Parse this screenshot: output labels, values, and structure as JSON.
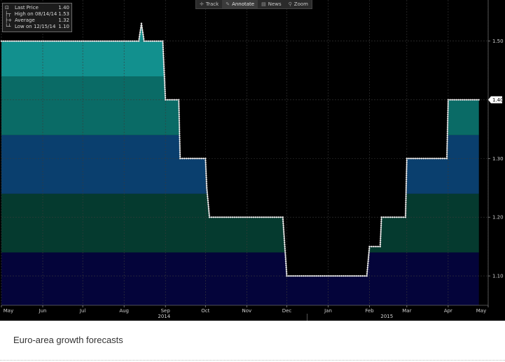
{
  "toolbar": {
    "items": [
      {
        "label": "Track",
        "icon": "crosshair-icon",
        "active": false
      },
      {
        "label": "Annotate",
        "icon": "pencil-icon",
        "active": true
      },
      {
        "label": "News",
        "icon": "news-icon",
        "active": false
      },
      {
        "label": "Zoom",
        "icon": "magnifier-icon",
        "active": false
      }
    ]
  },
  "legend": {
    "rows": [
      {
        "label": "Last Price",
        "value": "1.40"
      },
      {
        "label": "High on 08/14/14",
        "value": "1.53"
      },
      {
        "label": "Average",
        "value": "1.32"
      },
      {
        "label": "Low on 12/15/14",
        "value": "1.10"
      }
    ]
  },
  "caption": "Euro-area growth forecasts",
  "chart_data": {
    "type": "area",
    "title": "",
    "xlabel": "",
    "ylabel": "",
    "ylim": [
      1.05,
      1.57
    ],
    "x_range": [
      "2014-05-01",
      "2015-05-01"
    ],
    "x_ticks": [
      "May",
      "Jun",
      "Jul",
      "Aug",
      "Sep",
      "Oct",
      "Nov",
      "Dec",
      "Jan",
      "Feb",
      "Mar",
      "Apr",
      "May"
    ],
    "x_tick_dates": [
      "2014-05-01",
      "2014-06-01",
      "2014-07-01",
      "2014-08-01",
      "2014-09-01",
      "2014-10-01",
      "2014-11-01",
      "2014-12-01",
      "2015-01-01",
      "2015-02-01",
      "2015-03-01",
      "2015-04-01",
      "2015-05-01"
    ],
    "year_labels": [
      {
        "label": "2014",
        "date": "2014-08-31"
      },
      {
        "label": "2015",
        "date": "2015-02-14"
      }
    ],
    "y_ticks": [
      1.1,
      1.2,
      1.3,
      1.4,
      1.5
    ],
    "last_value_label": "1.40",
    "grid": true,
    "legend_position": "top-left",
    "series": [
      {
        "name": "Last Price",
        "points": [
          [
            "2014-05-01",
            1.5
          ],
          [
            "2014-08-12",
            1.5
          ],
          [
            "2014-08-14",
            1.53
          ],
          [
            "2014-08-16",
            1.5
          ],
          [
            "2014-08-30",
            1.5
          ],
          [
            "2014-09-01",
            1.4
          ],
          [
            "2014-09-11",
            1.4
          ],
          [
            "2014-09-12",
            1.3
          ],
          [
            "2014-10-01",
            1.3
          ],
          [
            "2014-10-02",
            1.25
          ],
          [
            "2014-10-04",
            1.2
          ],
          [
            "2014-11-28",
            1.2
          ],
          [
            "2014-12-01",
            1.1
          ],
          [
            "2015-01-30",
            1.1
          ],
          [
            "2015-02-01",
            1.15
          ],
          [
            "2015-02-09",
            1.15
          ],
          [
            "2015-02-10",
            1.2
          ],
          [
            "2015-02-28",
            1.2
          ],
          [
            "2015-03-01",
            1.3
          ],
          [
            "2015-03-31",
            1.3
          ],
          [
            "2015-04-01",
            1.4
          ],
          [
            "2015-04-24",
            1.4
          ]
        ]
      }
    ],
    "colors": {
      "background": "#000000",
      "band_1": "#04043a",
      "band_2": "#053a2f",
      "band_3": "#0a3f6e",
      "band_4": "#0a6b66",
      "band_5": "#12908e",
      "line": "#ffffff"
    }
  }
}
